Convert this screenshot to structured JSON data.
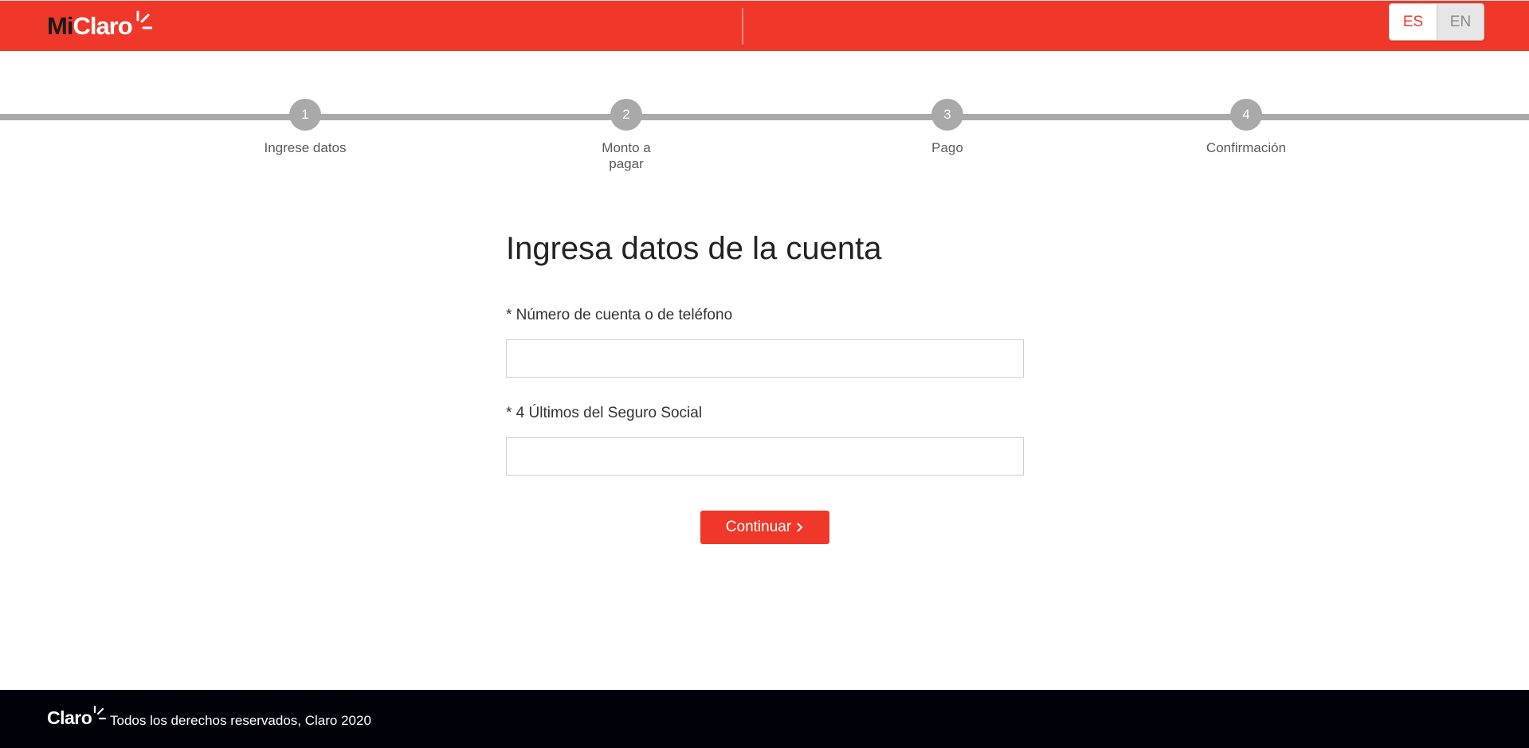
{
  "header": {
    "logo_mi": "Mi",
    "logo_claro": "Claro",
    "languages": [
      {
        "label": "ES",
        "active": true
      },
      {
        "label": "EN",
        "active": false
      }
    ]
  },
  "stepper": {
    "steps": [
      {
        "number": "1",
        "label": "Ingrese datos"
      },
      {
        "number": "2",
        "label": "Monto a pagar"
      },
      {
        "number": "3",
        "label": "Pago"
      },
      {
        "number": "4",
        "label": "Confirmación"
      }
    ]
  },
  "form": {
    "title": "Ingresa datos de la cuenta",
    "account_label": "* Número de cuenta o de teléfono",
    "account_value": "",
    "ssn_label": "* 4 Últimos del Seguro Social",
    "ssn_value": "",
    "continue_label": "Continuar",
    "continue_icon": "chevron-right-icon"
  },
  "footer": {
    "logo_claro": "Claro",
    "copyright": "Todos los derechos reservados, Claro 2020"
  },
  "colors": {
    "brand_red": "#ef3829",
    "stepper_gray": "#a9a9a9",
    "footer_bg": "#01010a"
  }
}
